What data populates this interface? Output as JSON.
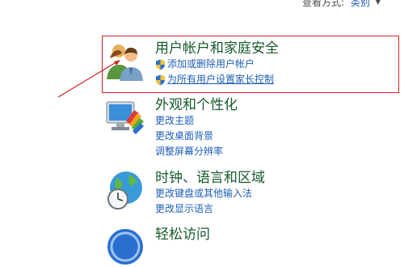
{
  "viewby": {
    "label": "查看方式:",
    "value": "类别"
  },
  "categories": [
    {
      "title": "用户帐户和家庭安全",
      "links": [
        "添加或删除用户帐户",
        "为所有用户设置家长控制"
      ]
    },
    {
      "title": "外观和个性化",
      "links": [
        "更改主题",
        "更改桌面背景",
        "调整屏幕分辨率"
      ]
    },
    {
      "title": "时钟、语言和区域",
      "links": [
        "更改键盘或其他输入法",
        "更改显示语言"
      ]
    },
    {
      "title": "轻松访问",
      "links": []
    }
  ],
  "colors": {
    "title": "#16592b",
    "link": "#1e5fb4",
    "highlight": "#d42020"
  }
}
